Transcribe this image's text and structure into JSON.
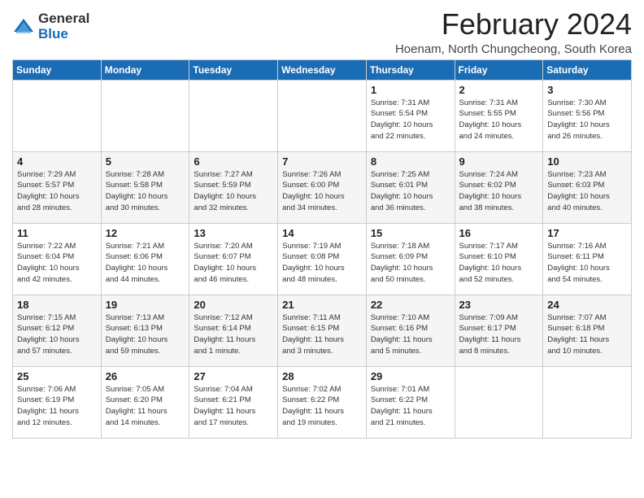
{
  "logo": {
    "general": "General",
    "blue": "Blue"
  },
  "title": "February 2024",
  "subtitle": "Hoenam, North Chungcheong, South Korea",
  "days_of_week": [
    "Sunday",
    "Monday",
    "Tuesday",
    "Wednesday",
    "Thursday",
    "Friday",
    "Saturday"
  ],
  "weeks": [
    [
      {
        "day": "",
        "info": ""
      },
      {
        "day": "",
        "info": ""
      },
      {
        "day": "",
        "info": ""
      },
      {
        "day": "",
        "info": ""
      },
      {
        "day": "1",
        "info": "Sunrise: 7:31 AM\nSunset: 5:54 PM\nDaylight: 10 hours\nand 22 minutes."
      },
      {
        "day": "2",
        "info": "Sunrise: 7:31 AM\nSunset: 5:55 PM\nDaylight: 10 hours\nand 24 minutes."
      },
      {
        "day": "3",
        "info": "Sunrise: 7:30 AM\nSunset: 5:56 PM\nDaylight: 10 hours\nand 26 minutes."
      }
    ],
    [
      {
        "day": "4",
        "info": "Sunrise: 7:29 AM\nSunset: 5:57 PM\nDaylight: 10 hours\nand 28 minutes."
      },
      {
        "day": "5",
        "info": "Sunrise: 7:28 AM\nSunset: 5:58 PM\nDaylight: 10 hours\nand 30 minutes."
      },
      {
        "day": "6",
        "info": "Sunrise: 7:27 AM\nSunset: 5:59 PM\nDaylight: 10 hours\nand 32 minutes."
      },
      {
        "day": "7",
        "info": "Sunrise: 7:26 AM\nSunset: 6:00 PM\nDaylight: 10 hours\nand 34 minutes."
      },
      {
        "day": "8",
        "info": "Sunrise: 7:25 AM\nSunset: 6:01 PM\nDaylight: 10 hours\nand 36 minutes."
      },
      {
        "day": "9",
        "info": "Sunrise: 7:24 AM\nSunset: 6:02 PM\nDaylight: 10 hours\nand 38 minutes."
      },
      {
        "day": "10",
        "info": "Sunrise: 7:23 AM\nSunset: 6:03 PM\nDaylight: 10 hours\nand 40 minutes."
      }
    ],
    [
      {
        "day": "11",
        "info": "Sunrise: 7:22 AM\nSunset: 6:04 PM\nDaylight: 10 hours\nand 42 minutes."
      },
      {
        "day": "12",
        "info": "Sunrise: 7:21 AM\nSunset: 6:06 PM\nDaylight: 10 hours\nand 44 minutes."
      },
      {
        "day": "13",
        "info": "Sunrise: 7:20 AM\nSunset: 6:07 PM\nDaylight: 10 hours\nand 46 minutes."
      },
      {
        "day": "14",
        "info": "Sunrise: 7:19 AM\nSunset: 6:08 PM\nDaylight: 10 hours\nand 48 minutes."
      },
      {
        "day": "15",
        "info": "Sunrise: 7:18 AM\nSunset: 6:09 PM\nDaylight: 10 hours\nand 50 minutes."
      },
      {
        "day": "16",
        "info": "Sunrise: 7:17 AM\nSunset: 6:10 PM\nDaylight: 10 hours\nand 52 minutes."
      },
      {
        "day": "17",
        "info": "Sunrise: 7:16 AM\nSunset: 6:11 PM\nDaylight: 10 hours\nand 54 minutes."
      }
    ],
    [
      {
        "day": "18",
        "info": "Sunrise: 7:15 AM\nSunset: 6:12 PM\nDaylight: 10 hours\nand 57 minutes."
      },
      {
        "day": "19",
        "info": "Sunrise: 7:13 AM\nSunset: 6:13 PM\nDaylight: 10 hours\nand 59 minutes."
      },
      {
        "day": "20",
        "info": "Sunrise: 7:12 AM\nSunset: 6:14 PM\nDaylight: 11 hours\nand 1 minute."
      },
      {
        "day": "21",
        "info": "Sunrise: 7:11 AM\nSunset: 6:15 PM\nDaylight: 11 hours\nand 3 minutes."
      },
      {
        "day": "22",
        "info": "Sunrise: 7:10 AM\nSunset: 6:16 PM\nDaylight: 11 hours\nand 5 minutes."
      },
      {
        "day": "23",
        "info": "Sunrise: 7:09 AM\nSunset: 6:17 PM\nDaylight: 11 hours\nand 8 minutes."
      },
      {
        "day": "24",
        "info": "Sunrise: 7:07 AM\nSunset: 6:18 PM\nDaylight: 11 hours\nand 10 minutes."
      }
    ],
    [
      {
        "day": "25",
        "info": "Sunrise: 7:06 AM\nSunset: 6:19 PM\nDaylight: 11 hours\nand 12 minutes."
      },
      {
        "day": "26",
        "info": "Sunrise: 7:05 AM\nSunset: 6:20 PM\nDaylight: 11 hours\nand 14 minutes."
      },
      {
        "day": "27",
        "info": "Sunrise: 7:04 AM\nSunset: 6:21 PM\nDaylight: 11 hours\nand 17 minutes."
      },
      {
        "day": "28",
        "info": "Sunrise: 7:02 AM\nSunset: 6:22 PM\nDaylight: 11 hours\nand 19 minutes."
      },
      {
        "day": "29",
        "info": "Sunrise: 7:01 AM\nSunset: 6:22 PM\nDaylight: 11 hours\nand 21 minutes."
      },
      {
        "day": "",
        "info": ""
      },
      {
        "day": "",
        "info": ""
      }
    ]
  ]
}
